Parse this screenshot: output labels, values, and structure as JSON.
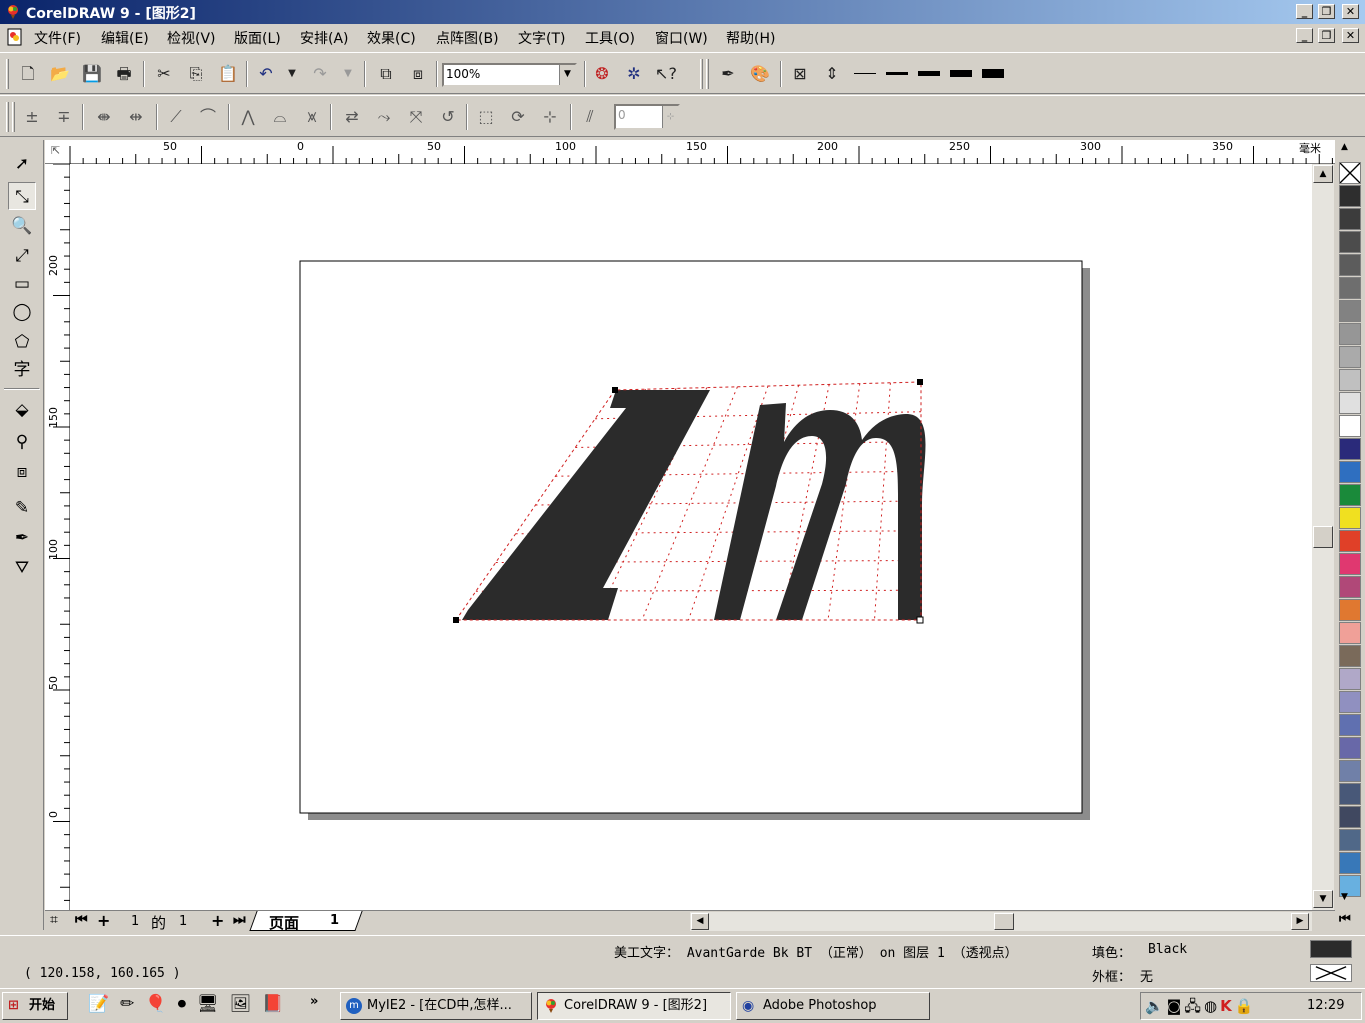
{
  "window": {
    "title": "CorelDRAW 9 - [图形2]"
  },
  "menu": [
    "文件(F)",
    "编辑(E)",
    "检视(V)",
    "版面(L)",
    "安排(A)",
    "效果(C)",
    "点阵图(B)",
    "文字(T)",
    "工具(O)",
    "窗口(W)",
    "帮助(H)"
  ],
  "toolbar": {
    "zoom_value": "100%",
    "nudge_value": "0"
  },
  "ruler": {
    "unit": "毫米",
    "h_labels": [
      "50",
      "0",
      "50",
      "100",
      "150",
      "200",
      "250",
      "300",
      "350"
    ],
    "v_labels": [
      "200",
      "150",
      "100",
      "50",
      "0"
    ]
  },
  "artwork": {
    "text": "Zm",
    "fill": "#2b2b2b",
    "envelope_color": "#d02020"
  },
  "page_nav": {
    "current": "1",
    "of": "的",
    "total": "1",
    "tab_label": "页面",
    "tab_num": "1"
  },
  "status": {
    "coords": "( 120.158,  160.165 )",
    "object_info": "美工文字： AvantGarde Bk BT （正常） on 图层 1  （透视点）",
    "fill_label": "填色：",
    "fill_value": "Black",
    "outline_label": "外框：",
    "outline_value": "无"
  },
  "palette_colors": [
    "#2e2e2e",
    "#3c3c3c",
    "#4c4c4c",
    "#5c5c5c",
    "#6e6e6e",
    "#828282",
    "#969696",
    "#aaaaaa",
    "#c0c0c0",
    "#e0e0e0",
    "#ffffff",
    "#2a2a7a",
    "#2f6fc0",
    "#1a8a3a",
    "#f0e020",
    "#e04028",
    "#e03870",
    "#b04878",
    "#e07830",
    "#f0a098",
    "#7a6a5a",
    "#b0a8c8",
    "#9090c0",
    "#6070b0",
    "#6868a8",
    "#7080a8",
    "#485878",
    "#404860",
    "#506888",
    "#3878b8",
    "#68b0e0"
  ],
  "taskbar": {
    "start_label": "开始",
    "tasks": [
      "MyIE2 - [在CD中,怎样...",
      "CorelDRAW 9 - [图形2]",
      "Adobe Photoshop"
    ],
    "clock": "12:29"
  },
  "icons": {
    "standard": [
      "new-icon",
      "open-icon",
      "save-icon",
      "print-icon",
      "cut-icon",
      "copy-icon",
      "paste-icon",
      "undo-icon",
      "redo-icon",
      "import-icon",
      "export-icon"
    ],
    "tools": [
      "pick-icon",
      "shape-icon",
      "zoom-icon",
      "freehand-icon",
      "rectangle-icon",
      "ellipse-icon",
      "polygon-icon",
      "text-icon",
      "interactive-fill-icon",
      "blend-icon",
      "extrude-icon",
      "eyedropper-icon",
      "outline-pen-icon",
      "fill-bucket-icon"
    ]
  }
}
